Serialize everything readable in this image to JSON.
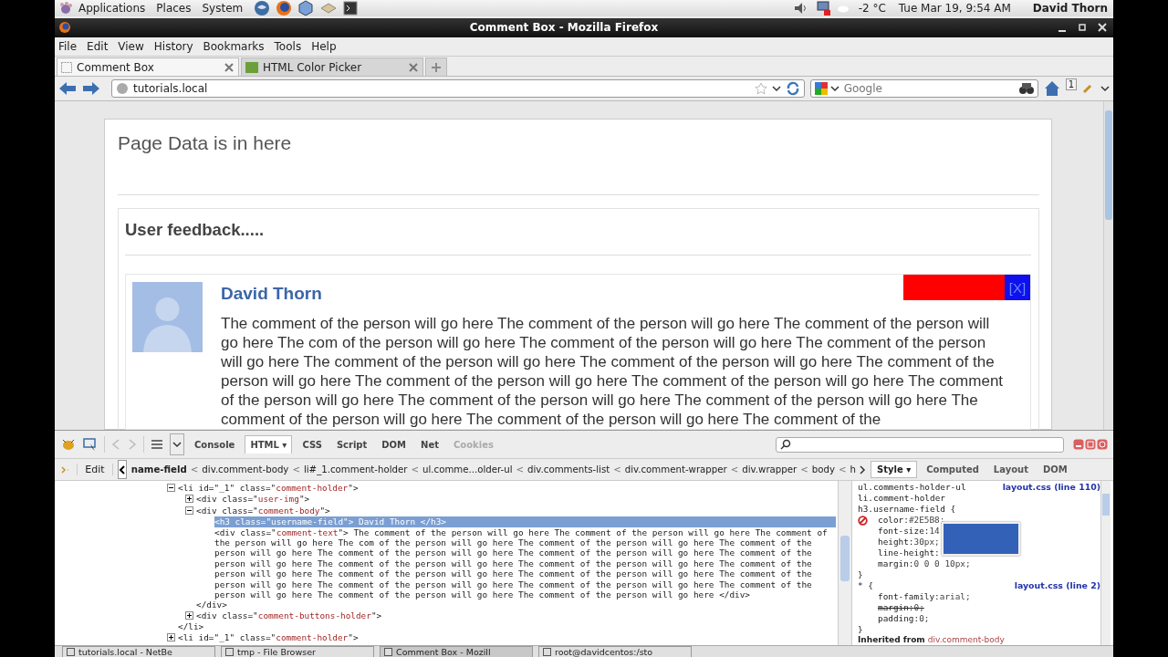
{
  "top_panel": {
    "menus": [
      "Applications",
      "Places",
      "System"
    ],
    "weather": "-2 °C",
    "clock": "Tue Mar 19,  9:54 AM",
    "user": "David Thorn"
  },
  "window": {
    "title": "Comment Box - Mozilla Firefox"
  },
  "menu_bar": [
    "File",
    "Edit",
    "View",
    "History",
    "Bookmarks",
    "Tools",
    "Help"
  ],
  "tabs": [
    {
      "label": "Comment Box",
      "selected": true
    },
    {
      "label": "HTML Color Picker",
      "selected": false
    }
  ],
  "address_bar": {
    "value": "tutorials.local"
  },
  "search": {
    "placeholder": "Google"
  },
  "home_badge": "1",
  "page": {
    "heading": "Page Data is in here",
    "section_title": "User feedback.....",
    "comment": {
      "name": "David Thorn",
      "close": "[X]",
      "text": "The comment of the person will go here The comment of the person will go here The comment of the person will go here The com of the person will go here The comment of the person will go here The comment of the person will go here The comment of the person will go here The comment of the person will go here The comment of the person will go here The comment of the person will go here The comment of the person will go here The comment of the person will go here The comment of the person will go here The comment of the person will go here The comment of the person will go here The comment of the person will go here The comment of the"
    }
  },
  "devtools": {
    "panels": [
      {
        "label": "Console",
        "selected": false,
        "disabled": false
      },
      {
        "label": "HTML ▾",
        "selected": true,
        "disabled": false
      },
      {
        "label": "CSS",
        "selected": false,
        "disabled": false
      },
      {
        "label": "Script",
        "selected": false,
        "disabled": false
      },
      {
        "label": "DOM",
        "selected": false,
        "disabled": false
      },
      {
        "label": "Net",
        "selected": false,
        "disabled": false
      },
      {
        "label": "Cookies",
        "selected": false,
        "disabled": true
      }
    ],
    "edit": "Edit",
    "breadcrumbs": [
      {
        "label": "name-field",
        "selected": true,
        "sep": "<"
      },
      {
        "label": "div.comment-body",
        "selected": false,
        "sep": "<"
      },
      {
        "label": "li#_1.comment-holder",
        "selected": false,
        "sep": "<"
      },
      {
        "label": "ul.comme...older-ul",
        "selected": false,
        "sep": "<"
      },
      {
        "label": "div.comments-list",
        "selected": false,
        "sep": "<"
      },
      {
        "label": "div.comment-wrapper",
        "selected": false,
        "sep": "<"
      },
      {
        "label": "div.wrapper",
        "selected": false,
        "sep": "<"
      },
      {
        "label": "body",
        "selected": false,
        "sep": "<"
      },
      {
        "label": "h",
        "selected": false
      }
    ],
    "side_tabs": [
      {
        "label": "Style ▾",
        "selected": true
      },
      {
        "label": "Computed",
        "selected": false
      },
      {
        "label": "Layout",
        "selected": false
      },
      {
        "label": "DOM",
        "selected": false
      }
    ],
    "tree": [
      {
        "kind": "element",
        "expanded": true,
        "selected": false,
        "parts": [
          {
            "kind": "tag",
            "text": "<li id=\"_1\" class=\""
          },
          {
            "kind": "value",
            "text": "comment-holder"
          },
          {
            "kind": "tag",
            "text": "\">"
          }
        ],
        "close": "</li>",
        "children": [
          {
            "kind": "element",
            "expanded": false,
            "selected": false,
            "parts": [
              {
                "kind": "tag",
                "text": "<div class=\""
              },
              {
                "kind": "value",
                "text": "user-img"
              },
              {
                "kind": "tag",
                "text": "\">"
              }
            ]
          },
          {
            "kind": "element",
            "expanded": true,
            "selected": false,
            "parts": [
              {
                "kind": "tag",
                "text": "<div class=\""
              },
              {
                "kind": "value",
                "text": "comment-body"
              },
              {
                "kind": "tag",
                "text": "\">"
              }
            ],
            "close": "</div>",
            "children": [
              {
                "kind": "leaf",
                "selected": true,
                "parts": [
                  {
                    "kind": "tag",
                    "text": "<h3 class=\"username-field\"> David Thorn </h3>"
                  }
                ]
              },
              {
                "kind": "leaf",
                "selected": false,
                "parts": [
                  {
                    "kind": "tag",
                    "text": "<div class=\""
                  },
                  {
                    "kind": "value",
                    "text": "comment-text"
                  },
                  {
                    "kind": "tag",
                    "text": "\"> The comment of the person will go here The comment of the person will go here The comment of the person will go here The com of the person will go here The comment of the person will go here The comment of the person will go here The comment of the person will go here The comment of the person will go here The comment of the person will go here The comment of the person will go here The comment of the person will go here The comment of the person will go here The comment of the person will go here The comment of the person will go here The comment of the person will go here The comment of the person will go here The comment of the person will go here The comment of the person will go here The comment of the person will go here The comment of the person will go here </div>"
                  }
                ]
              }
            ]
          },
          {
            "kind": "element",
            "expanded": false,
            "selected": false,
            "parts": [
              {
                "kind": "tag",
                "text": "<div class=\""
              },
              {
                "kind": "value",
                "text": "comment-buttons-holder"
              },
              {
                "kind": "tag",
                "text": "\">"
              }
            ]
          }
        ]
      },
      {
        "kind": "element",
        "expanded": false,
        "selected": false,
        "parts": [
          {
            "kind": "tag",
            "text": "<li id=\"_1\" class=\""
          },
          {
            "kind": "value",
            "text": "comment-holder"
          },
          {
            "kind": "tag",
            "text": "\">"
          }
        ]
      }
    ],
    "style_rules": [
      {
        "selectors": [
          "ul.comments-holder-ul",
          "li.comment-holder",
          "h3.username-field {"
        ],
        "source": "layout.css (line 110)",
        "close": "}",
        "props": [
          {
            "name": "color:",
            "value": "#2E5B8;",
            "disabled": true,
            "overridden": false
          },
          {
            "name": "font-size:",
            "value": "14",
            "disabled": false,
            "overridden": false
          },
          {
            "name": "height:",
            "value": "30px;",
            "disabled": false,
            "overridden": false
          },
          {
            "name": "line-height:",
            "disabled": false,
            "overridden": false
          },
          {
            "name": "margin:",
            "value": "0 0 0 10px;",
            "disabled": false,
            "overridden": false
          }
        ]
      },
      {
        "selectors": [
          "* {"
        ],
        "source": "layout.css (line 2)",
        "close": "}",
        "props": [
          {
            "name": "font-family:",
            "value": "arial;",
            "disabled": false,
            "overridden": false
          },
          {
            "name": "margin:",
            "value": "0;",
            "disabled": false,
            "overridden": true
          },
          {
            "name": "padding:",
            "value": "0;",
            "disabled": false,
            "overridden": false
          }
        ]
      }
    ],
    "inherited": {
      "label": "Inherited from",
      "selector": "div.comment-body"
    }
  },
  "taskbar": [
    {
      "label": "tutorials.local - NetBe",
      "selected": false
    },
    {
      "label": "tmp - File Browser",
      "selected": false
    },
    {
      "label": "Comment Box - Mozill",
      "selected": true
    },
    {
      "label": "root@davidcentos:/sto",
      "selected": false
    }
  ]
}
